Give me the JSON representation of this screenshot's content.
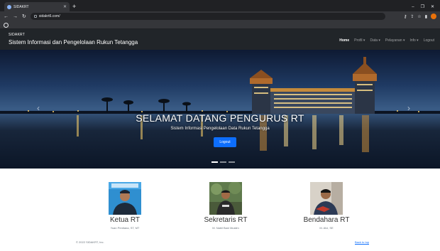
{
  "browser": {
    "tab_title": "SIDAKRT",
    "new_tab": "+",
    "url": "sidakrt6.com/",
    "window_controls": {
      "minimize": "–",
      "restore": "❐",
      "close": "✕"
    }
  },
  "navbar": {
    "brand": "SIDAKRT",
    "subtitle": "Sistem Informasi dan Pengelolaan Rukun Tetangga",
    "menu": [
      "Home",
      "Profil ▾",
      "Data ▾",
      "Pelayanan ▾",
      "Info ▾",
      "Logout"
    ]
  },
  "hero": {
    "title": "SELAMAT DATANG PENGURUS RT",
    "subtitle": "Sistem Informasi Pengelolaan Data Rukun Tetangga",
    "button": "Logout",
    "prev_icon": "‹",
    "next_icon": "›"
  },
  "members": [
    {
      "role": "Ketua RT",
      "name": "Yoan Pentiana, ST, MT"
    },
    {
      "role": "Sekretaris RT",
      "name": "M. Nabil Bani Muslim"
    },
    {
      "role": "Bendahara RT",
      "name": "M. Alvi, SE"
    }
  ],
  "footer": {
    "copyright": "© 2022 SIDAKRT, Inc.",
    "back_to_top": "Back to top"
  },
  "colors": {
    "primary": "#0d6efd",
    "navbar": "#212529"
  }
}
